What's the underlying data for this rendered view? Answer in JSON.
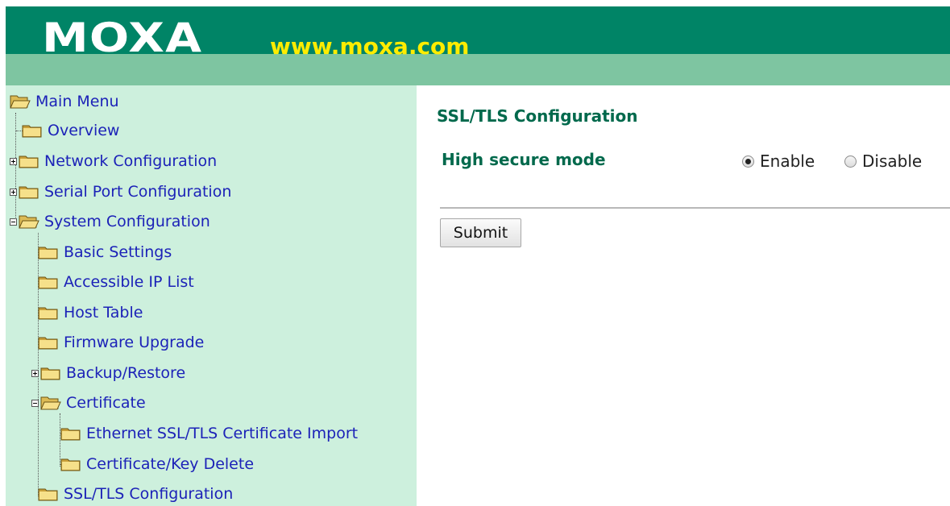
{
  "header": {
    "logo_text": "MOXA",
    "website": "www.moxa.com"
  },
  "colors": {
    "header_dark": "#008466",
    "header_light": "#7ec5a1",
    "sidebar_bg": "#cdf0dd",
    "link": "#1c22b8",
    "heading": "#00694c",
    "tagline": "#ffec00"
  },
  "sidebar": {
    "items": [
      {
        "label": "Main Menu",
        "icon": "folder-open-icon",
        "expander": "none"
      },
      {
        "label": "Overview",
        "icon": "folder-icon",
        "expander": "none"
      },
      {
        "label": "Network Configuration",
        "icon": "folder-icon",
        "expander": "plus"
      },
      {
        "label": "Serial Port Configuration",
        "icon": "folder-icon",
        "expander": "plus"
      },
      {
        "label": "System Configuration",
        "icon": "folder-open-icon",
        "expander": "minus"
      },
      {
        "label": "Basic Settings",
        "icon": "folder-icon",
        "expander": "none"
      },
      {
        "label": "Accessible IP List",
        "icon": "folder-icon",
        "expander": "none"
      },
      {
        "label": "Host Table",
        "icon": "folder-icon",
        "expander": "none"
      },
      {
        "label": "Firmware Upgrade",
        "icon": "folder-icon",
        "expander": "none"
      },
      {
        "label": "Backup/Restore",
        "icon": "folder-icon",
        "expander": "plus"
      },
      {
        "label": "Certificate",
        "icon": "folder-open-icon",
        "expander": "minus"
      },
      {
        "label": "Ethernet SSL/TLS Certificate Import",
        "icon": "folder-icon",
        "expander": "none"
      },
      {
        "label": "Certificate/Key Delete",
        "icon": "folder-icon",
        "expander": "none"
      },
      {
        "label": "SSL/TLS Configuration",
        "icon": "folder-icon",
        "expander": "none"
      }
    ]
  },
  "main": {
    "title": "SSL/TLS Configuration",
    "high_secure_mode": {
      "label": "High secure mode",
      "options": [
        "Enable",
        "Disable"
      ],
      "selected": "Enable"
    },
    "submit_label": "Submit"
  }
}
